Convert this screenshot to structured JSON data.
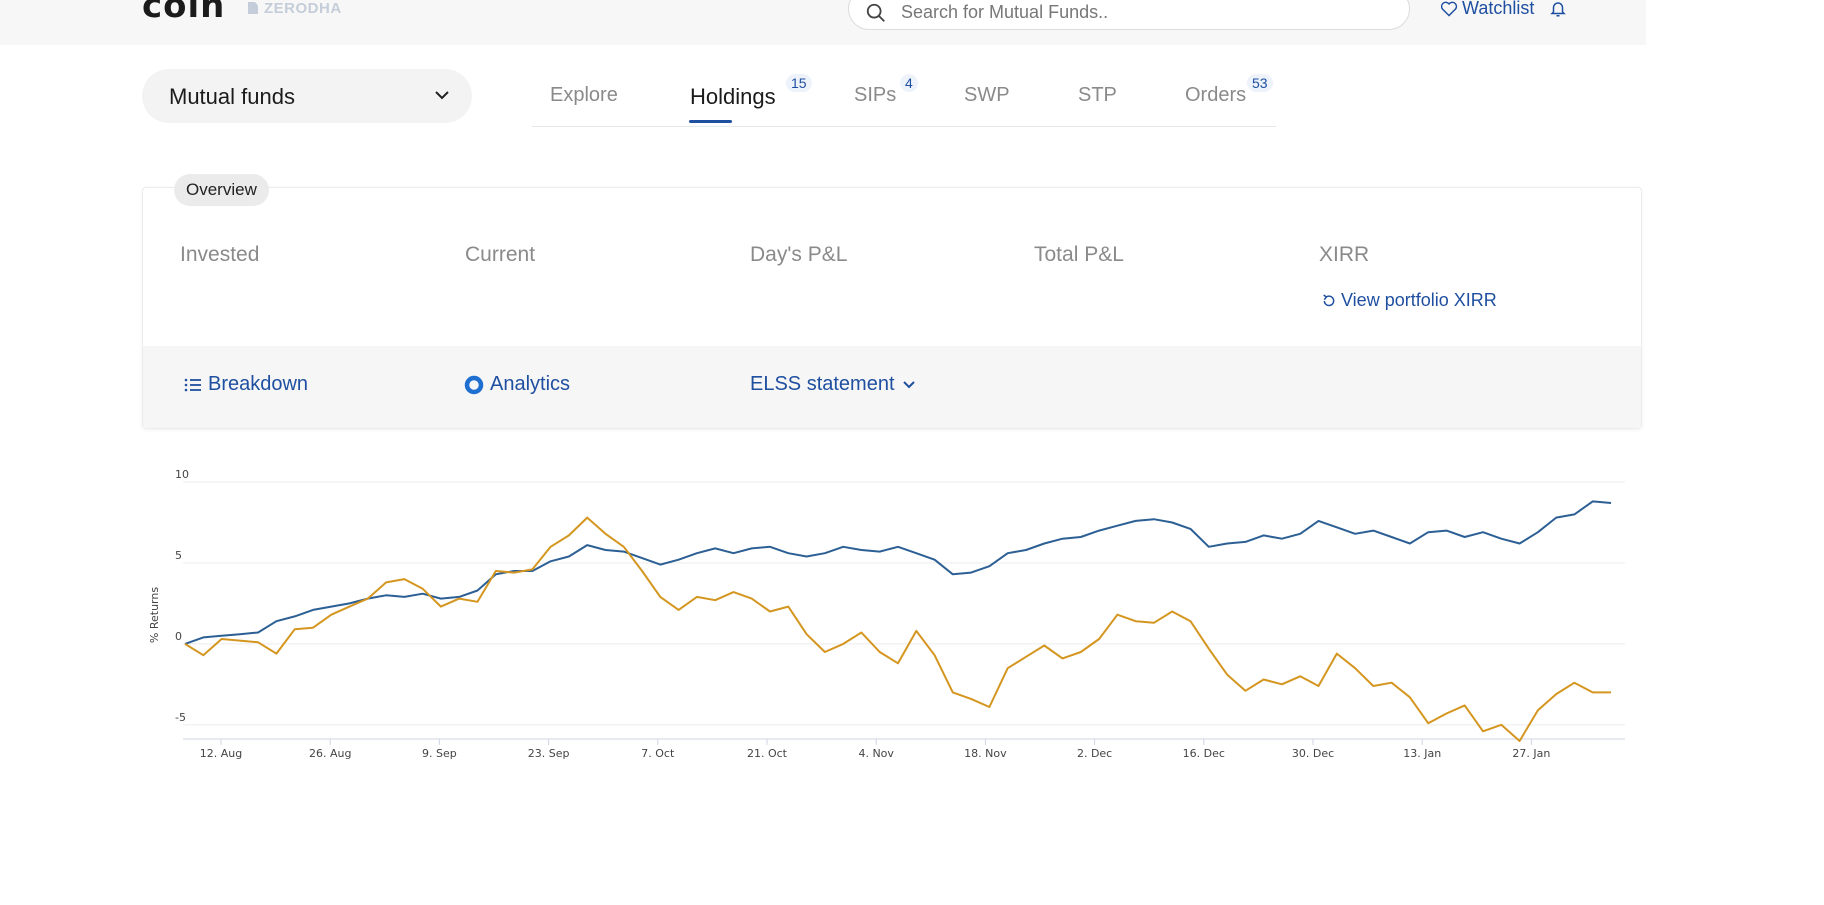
{
  "header": {
    "logo_text": "coin",
    "brand_text": "ZERODHA",
    "search_placeholder": "Search for Mutual Funds..",
    "watchlist_label": "Watchlist"
  },
  "dropdown": {
    "selected": "Mutual funds"
  },
  "tabs": [
    {
      "label": "Explore",
      "badge": ""
    },
    {
      "label": "Holdings",
      "badge": "15"
    },
    {
      "label": "SIPs",
      "badge": "4"
    },
    {
      "label": "SWP",
      "badge": ""
    },
    {
      "label": "STP",
      "badge": ""
    },
    {
      "label": "Orders",
      "badge": "53"
    }
  ],
  "overview": {
    "title": "Overview",
    "stats": [
      "Invested",
      "Current",
      "Day's P&L",
      "Total P&L",
      "XIRR"
    ],
    "xirr_link": "View portfolio XIRR",
    "breakdown": "Breakdown",
    "analytics": "Analytics",
    "elss": "ELSS statement"
  },
  "colors": {
    "accent": "#1f4fa0",
    "series_blue": "#2c5f94",
    "series_gold": "#d4961f"
  },
  "chart_data": {
    "type": "line",
    "ylabel": "% Returns",
    "yticks": [
      "10",
      "5",
      "0",
      "-5"
    ],
    "ylim": [
      -6,
      10
    ],
    "xticks": [
      "12. Aug",
      "26. Aug",
      "9. Sep",
      "23. Sep",
      "7. Oct",
      "21. Oct",
      "4. Nov",
      "18. Nov",
      "2. Dec",
      "16. Dec",
      "30. Dec",
      "13. Jan",
      "27. Jan"
    ],
    "grid": true,
    "series": [
      {
        "values": [
          0,
          0.4,
          0.5,
          0.6,
          0.7,
          1.4,
          1.7,
          2.1,
          2.3,
          2.5,
          2.8,
          3.0,
          2.9,
          3.1,
          2.8,
          2.9,
          3.3,
          4.3,
          4.5,
          4.5,
          5.1,
          5.4,
          6.1,
          5.8,
          5.7,
          5.3,
          4.9,
          5.2,
          5.6,
          5.9,
          5.6,
          5.9,
          6.0,
          5.6,
          5.4,
          5.6,
          6.0,
          5.8,
          5.7,
          6.0,
          5.6,
          5.2,
          4.3,
          4.4,
          4.8,
          5.6,
          5.8,
          6.2,
          6.5,
          6.6,
          7.0,
          7.3,
          7.6,
          7.7,
          7.5,
          7.1,
          6.0,
          6.2,
          6.3,
          6.7,
          6.5,
          6.8,
          7.6,
          7.2,
          6.8,
          7.0,
          6.6,
          6.2,
          6.9,
          7.0,
          6.6,
          6.9,
          6.5,
          6.2,
          6.9,
          7.8,
          8.0,
          8.8,
          8.7
        ]
      },
      {
        "values": [
          0,
          -0.7,
          0.3,
          0.2,
          0.1,
          -0.6,
          0.9,
          1.0,
          1.8,
          2.3,
          2.8,
          3.8,
          4.0,
          3.4,
          2.3,
          2.8,
          2.6,
          4.5,
          4.4,
          4.6,
          6.0,
          6.7,
          7.8,
          6.8,
          6.0,
          4.5,
          2.9,
          2.1,
          2.9,
          2.7,
          3.2,
          2.8,
          2.0,
          2.3,
          0.6,
          -0.5,
          0.0,
          0.7,
          -0.5,
          -1.2,
          0.8,
          -0.7,
          -3.0,
          -3.4,
          -3.9,
          -1.5,
          -0.8,
          -0.1,
          -0.9,
          -0.5,
          0.3,
          1.8,
          1.4,
          1.3,
          2.0,
          1.4,
          -0.3,
          -1.9,
          -2.9,
          -2.2,
          -2.5,
          -2.0,
          -2.6,
          -0.6,
          -1.5,
          -2.6,
          -2.4,
          -3.3,
          -4.9,
          -4.3,
          -3.8,
          -5.4,
          -5.0,
          -6.0,
          -4.1,
          -3.1,
          -2.4,
          -3.0,
          -3.0
        ]
      }
    ]
  }
}
